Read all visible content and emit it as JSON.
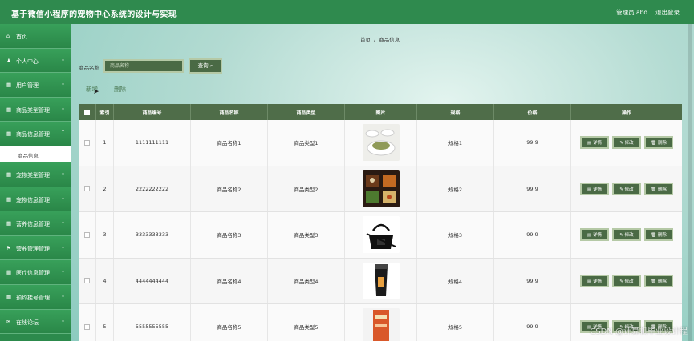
{
  "header": {
    "title": "基于微信小程序的宠物中心系统的设计与实现",
    "admin": "管理员 abo",
    "logout": "退出登录",
    "bg_color": "#2f8a4e"
  },
  "sidebar": {
    "items": [
      {
        "label": "首页",
        "icon": "home-icon",
        "glyph": "⌂"
      },
      {
        "label": "个人中心",
        "icon": "user-icon",
        "glyph": "♟"
      },
      {
        "label": "用户管理",
        "icon": "grid-icon",
        "glyph": "▦"
      },
      {
        "label": "商品类型管理",
        "icon": "grid-icon",
        "glyph": "▦"
      },
      {
        "label": "商品信息管理",
        "icon": "grid-icon",
        "glyph": "▦"
      },
      {
        "label": "宠物类型管理",
        "icon": "grid-icon",
        "glyph": "▦"
      },
      {
        "label": "宠物信息管理",
        "icon": "grid-icon",
        "glyph": "▦"
      },
      {
        "label": "营养信息管理",
        "icon": "grid-icon",
        "glyph": "▦"
      },
      {
        "label": "营养管理管理",
        "icon": "flag-icon",
        "glyph": "⚑"
      },
      {
        "label": "医疗信息管理",
        "icon": "grid-icon",
        "glyph": "▦"
      },
      {
        "label": "预约挂号管理",
        "icon": "grid-icon",
        "glyph": "▦"
      },
      {
        "label": "在线论坛",
        "icon": "chat-icon",
        "glyph": "✉"
      }
    ],
    "subitem": "商品信息"
  },
  "breadcrumb": {
    "home": "首页",
    "sep": "/",
    "current": "商品信息"
  },
  "search": {
    "label": "商品名称",
    "placeholder": "商品名称",
    "button": "查询 ⌕"
  },
  "actions": {
    "add": "新增",
    "delete": "删除"
  },
  "table": {
    "headers": [
      "索引",
      "商品编号",
      "商品名称",
      "商品类型",
      "图片",
      "规格",
      "价格",
      "操作"
    ],
    "buttons": {
      "detail": "▤ 详情",
      "edit": "✎ 修改",
      "delete": "🗑 删除"
    },
    "rows": [
      {
        "index": "1",
        "code": "1111111111",
        "name": "商品名称1",
        "type": "商品类型1",
        "spec": "规格1",
        "price": "99.9"
      },
      {
        "index": "2",
        "code": "2222222222",
        "name": "商品名称2",
        "type": "商品类型2",
        "spec": "规格2",
        "price": "99.9"
      },
      {
        "index": "3",
        "code": "3333333333",
        "name": "商品名称3",
        "type": "商品类型3",
        "spec": "规格3",
        "price": "99.9"
      },
      {
        "index": "4",
        "code": "4444444444",
        "name": "商品名称4",
        "type": "商品类型4",
        "spec": "规格4",
        "price": "99.9"
      },
      {
        "index": "5",
        "code": "5555555555",
        "name": "商品名称5",
        "type": "商品类型5",
        "spec": "规格5",
        "price": "99.9"
      }
    ]
  },
  "watermark": "CSDN @计算机毕业设计程"
}
